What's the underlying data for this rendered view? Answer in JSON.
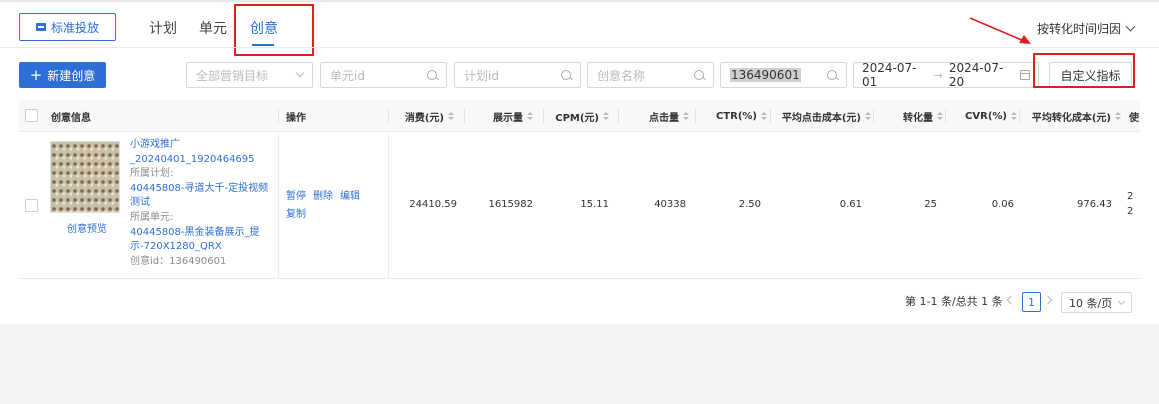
{
  "toolbar": {
    "standard_delivery": "标准投放",
    "tabs": [
      {
        "label": "计划",
        "active": false
      },
      {
        "label": "单元",
        "active": false
      },
      {
        "label": "创意",
        "active": true
      }
    ],
    "attribution_select": "按转化时间归因"
  },
  "filters": {
    "new_button": "新建创意",
    "marketing_goal_placeholder": "全部营销目标",
    "unit_id_placeholder": "单元id",
    "plan_id_placeholder": "计划id",
    "creative_name_placeholder": "创意名称",
    "creative_id_value": "136490601",
    "date_start": "2024-07-01",
    "date_end": "2024-07-20",
    "date_separator": "→",
    "custom_metrics_button": "自定义指标"
  },
  "table": {
    "headers": {
      "creative_info": "创意信息",
      "action": "操作",
      "spend": "消费(元)",
      "impressions": "展示量",
      "cpm": "CPM(元)",
      "clicks": "点击量",
      "ctr": "CTR(%)",
      "avg_click_cost": "平均点击成本(元)",
      "conversions": "转化量",
      "cvr": "CVR(%)",
      "avg_conv_cost": "平均转化成本(元)",
      "next_partial": "使"
    },
    "row": {
      "preview_label": "创意预览",
      "creative_name_line1": "小游戏推广",
      "creative_name_line2": "_20240401_1920464695",
      "plan_label": "所属计划:",
      "plan_name_line1": "40445808-寻道大千-定投视频",
      "plan_name_line2": "测试",
      "unit_label": "所属单元:",
      "unit_name_line1": "40445808-黑金装备展示_提",
      "unit_name_line2": "示-720X1280_QRX",
      "creative_id_text": "创意id：136490601",
      "actions": {
        "pause": "暂停",
        "delete": "删除",
        "edit": "编辑",
        "copy": "复制"
      },
      "spend": "24410.59",
      "impressions": "1615982",
      "cpm": "15.11",
      "clicks": "40338",
      "ctr": "2.50",
      "avg_click_cost": "0.61",
      "conversions": "25",
      "cvr": "0.06",
      "avg_conv_cost": "976.43",
      "overflow_1": "2",
      "overflow_2": "2"
    }
  },
  "pagination": {
    "total_text": "第 1-1 条/总共 1 条",
    "current_page": "1",
    "page_size": "10 条/页"
  },
  "colors": {
    "accent": "#2d6fd6",
    "annotation_red": "#e01e1e"
  }
}
